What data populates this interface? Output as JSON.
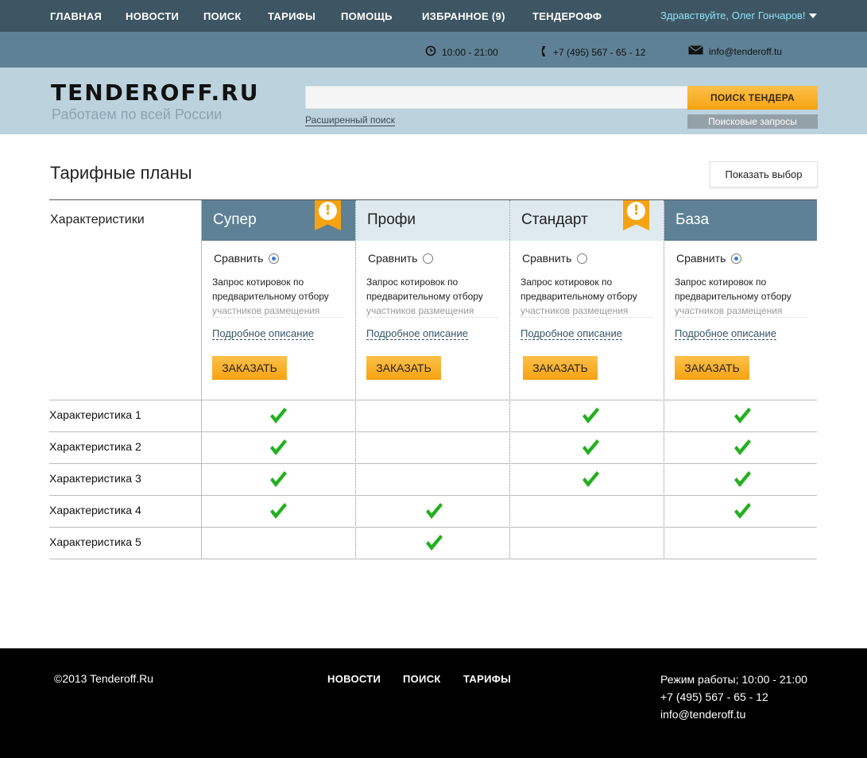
{
  "nav": {
    "items": [
      "ГЛАВНАЯ",
      "НОВОСТИ",
      "ПОИСК",
      "ТАРИФЫ",
      "ПОМОЩЬ",
      "ИЗБРАННОЕ (9)",
      "ТЕНДЕРОФФ"
    ],
    "greeting": "Здравствуйте, Олег Гончаров!"
  },
  "info": {
    "hours": "10:00 - 21:00",
    "phone": "+7 (495) 567 - 65 - 12",
    "email": "info@tenderoff.tu"
  },
  "header": {
    "logo": "TENDEROFF.RU",
    "tagline": "Работаем по всей России",
    "search_placeholder": "",
    "search_button": "ПОИСК ТЕНДЕРА",
    "advanced_link": "Расширенный поиск",
    "queries_button": "Поисковые запросы"
  },
  "main": {
    "title": "Тарифные планы",
    "show_button": "Показать выбор",
    "characteristics_heading": "Характеристики",
    "plans": [
      {
        "name": "Супер",
        "compare": "Сравнить",
        "compare_checked": true,
        "desc1": "Запрос котировок по предварительному отбору",
        "desc2": "участников размещения",
        "more": "Подробное описание",
        "order": "ЗАКАЗАТЬ"
      },
      {
        "name": "Профи",
        "compare": "Сравнить",
        "compare_checked": false,
        "desc1": "Запрос котировок по предварительному отбору",
        "desc2": "участников размещения",
        "more": "Подробное описание",
        "order": "ЗАКАЗАТЬ"
      },
      {
        "name": "Стандарт",
        "compare": "Сравнить",
        "compare_checked": false,
        "desc1": "Запрос котировок по предварительному отбору",
        "desc2": "участников размещения",
        "more": "Подробное описание",
        "order": "ЗАКАЗАТЬ"
      },
      {
        "name": "База",
        "compare": "Сравнить",
        "compare_checked": true,
        "desc1": "Запрос котировок по предварительному отбору",
        "desc2": "участников размещения",
        "more": "Подробное описание",
        "order": "ЗАКАЗАТЬ"
      }
    ],
    "features": [
      {
        "label": "Характеристика 1",
        "checks": [
          true,
          false,
          true,
          true
        ]
      },
      {
        "label": "Характеристика 2",
        "checks": [
          true,
          false,
          true,
          true
        ]
      },
      {
        "label": "Характеристика 3",
        "checks": [
          true,
          false,
          true,
          true
        ]
      },
      {
        "label": "Характеристика 4",
        "checks": [
          true,
          true,
          false,
          true
        ]
      },
      {
        "label": "Характеристика 5",
        "checks": [
          false,
          true,
          false,
          false
        ]
      }
    ]
  },
  "footer": {
    "copyright": "©2013 Tenderoff.Ru",
    "nav": [
      "НОВОСТИ",
      "ПОИСК",
      "ТАРИФЫ"
    ],
    "hours": "Режим работы; 10:00 - 21:00",
    "phone": "+7 (495) 567 - 65 - 12",
    "email": "info@tenderoff.tu"
  },
  "colors": {
    "nav_bg": "#3e5663",
    "info_bg": "#5e8195",
    "header_bg": "#bcd3de",
    "accent_orange": "#f6a312",
    "check_green": "#22b01e"
  },
  "icons": {
    "clock": "clock-icon",
    "phone": "phone-icon",
    "mail": "mail-icon",
    "check": "checkmark-icon",
    "alert": "exclamation-ribbon-icon"
  }
}
